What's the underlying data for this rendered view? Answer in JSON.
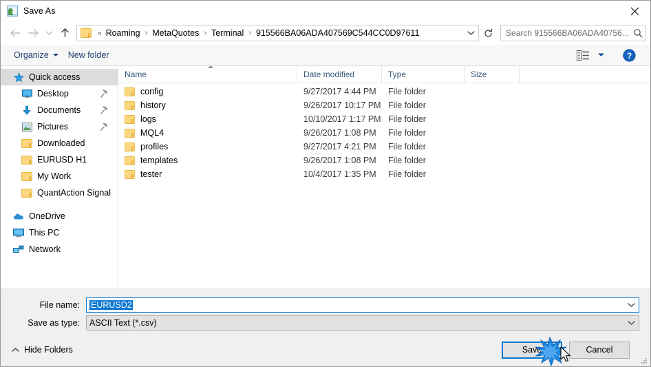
{
  "window": {
    "title": "Save As",
    "icon": "save-as-app-icon",
    "close_label": "✕"
  },
  "nav": {
    "back": "back-arrow-icon",
    "forward": "forward-arrow-icon",
    "recent": "recent-locations-chevron-icon",
    "up": "up-arrow-icon",
    "breadcrumb_prefix": "«",
    "breadcrumbs": [
      "Roaming",
      "MetaQuotes",
      "Terminal",
      "915566BA06ADA407569C544CC0D97611"
    ],
    "dropdown": "chevron-down-icon",
    "refresh": "refresh-icon"
  },
  "search": {
    "placeholder": "Search 915566BA06ADA40756...",
    "value": "",
    "icon": "search-icon"
  },
  "commandbar": {
    "organize": "Organize",
    "new_folder": "New folder",
    "view_icon": "view-layout-icon",
    "view_caret": "chevron-down-icon",
    "help_icon": "help-question-icon"
  },
  "sidebar": {
    "items": [
      {
        "label": "Quick access",
        "icon": "star-pin-icon",
        "selected": true,
        "indent": false,
        "pinned": false
      },
      {
        "label": "Desktop",
        "icon": "desktop-icon",
        "selected": false,
        "indent": true,
        "pinned": true
      },
      {
        "label": "Documents",
        "icon": "documents-download-icon",
        "selected": false,
        "indent": true,
        "pinned": true
      },
      {
        "label": "Pictures",
        "icon": "pictures-icon",
        "selected": false,
        "indent": true,
        "pinned": true
      },
      {
        "label": "Downloaded",
        "icon": "folder-icon",
        "selected": false,
        "indent": true,
        "pinned": false
      },
      {
        "label": "EURUSD H1",
        "icon": "folder-icon",
        "selected": false,
        "indent": true,
        "pinned": false
      },
      {
        "label": "My Work",
        "icon": "folder-icon",
        "selected": false,
        "indent": true,
        "pinned": false
      },
      {
        "label": "QuantAction Signal",
        "icon": "folder-icon",
        "selected": false,
        "indent": true,
        "pinned": false
      }
    ],
    "roots": [
      {
        "label": "OneDrive",
        "icon": "onedrive-cloud-icon"
      },
      {
        "label": "This PC",
        "icon": "this-pc-icon"
      },
      {
        "label": "Network",
        "icon": "network-icon"
      }
    ]
  },
  "filelist": {
    "columns": [
      "Name",
      "Date modified",
      "Type",
      "Size"
    ],
    "sorted_by": "Name",
    "rows": [
      {
        "name": "config",
        "date": "9/27/2017 4:44 PM",
        "type": "File folder",
        "size": ""
      },
      {
        "name": "history",
        "date": "9/26/2017 10:17 PM",
        "type": "File folder",
        "size": ""
      },
      {
        "name": "logs",
        "date": "10/10/2017 1:17 PM",
        "type": "File folder",
        "size": ""
      },
      {
        "name": "MQL4",
        "date": "9/26/2017 1:08 PM",
        "type": "File folder",
        "size": ""
      },
      {
        "name": "profiles",
        "date": "9/27/2017 4:21 PM",
        "type": "File folder",
        "size": ""
      },
      {
        "name": "templates",
        "date": "9/26/2017 1:08 PM",
        "type": "File folder",
        "size": ""
      },
      {
        "name": "tester",
        "date": "10/4/2017 1:35 PM",
        "type": "File folder",
        "size": ""
      }
    ]
  },
  "form": {
    "filename_label": "File name:",
    "filename_value": "EURUSD2",
    "filetype_label": "Save as type:",
    "filetype_value": "ASCII Text (*.csv)"
  },
  "footer": {
    "hide_folders": "Hide Folders",
    "hide_folders_icon": "chevron-up-icon",
    "save": "Save",
    "cancel": "Cancel"
  },
  "colors": {
    "accent": "#0a78d2",
    "selection": "#0a78d2",
    "sidebar_selected": "#dcdcdc",
    "folder_yellow": "#fcd77f",
    "column_header_text": "#39577c"
  }
}
